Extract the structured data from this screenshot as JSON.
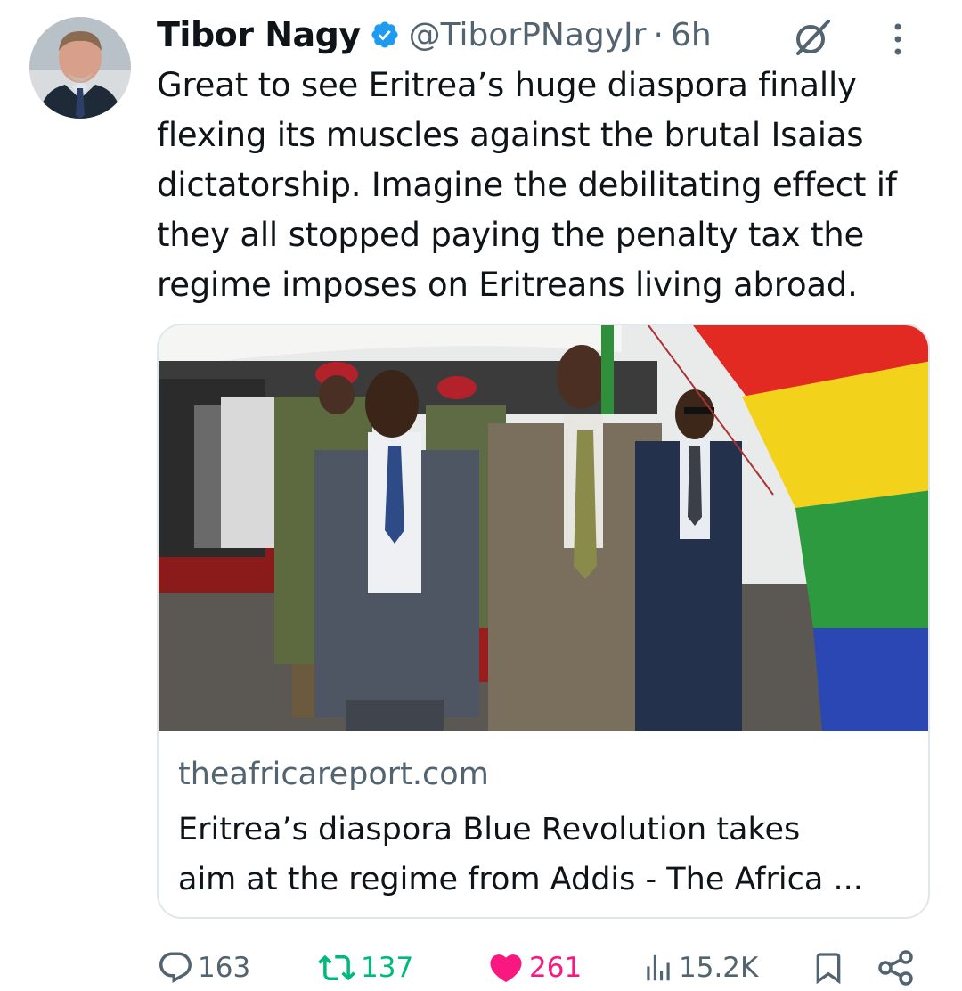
{
  "author": {
    "name": "Tibor Nagy",
    "handle": "@TiborPNagyJr",
    "separator": "·",
    "time": "6h"
  },
  "tweet": {
    "lines": [
      "Great to see Eritrea’s huge diaspora finally",
      "flexing its muscles against the brutal Isaias",
      "dictatorship. Imagine the debilitating effect if",
      "they all stopped paying the penalty tax the",
      "regime imposes on Eritreans living abroad."
    ]
  },
  "card": {
    "domain": "theafricareport.com",
    "title_lines": [
      "Eritrea’s diaspora Blue Revolution takes",
      "aim at the regime from Addis - The Africa ..."
    ]
  },
  "actions": {
    "replies": "163",
    "retweets": "137",
    "likes": "261",
    "views": "15.2K"
  },
  "colors": {
    "verified": "#1d9bf0",
    "retweet_active": "#00ba7c",
    "like_active": "#f91880",
    "secondary_text": "#536471"
  },
  "icons": [
    "verified-badge-icon",
    "grok-icon",
    "more-icon",
    "reply-icon",
    "retweet-icon",
    "like-icon",
    "views-icon",
    "bookmark-icon",
    "share-icon"
  ]
}
